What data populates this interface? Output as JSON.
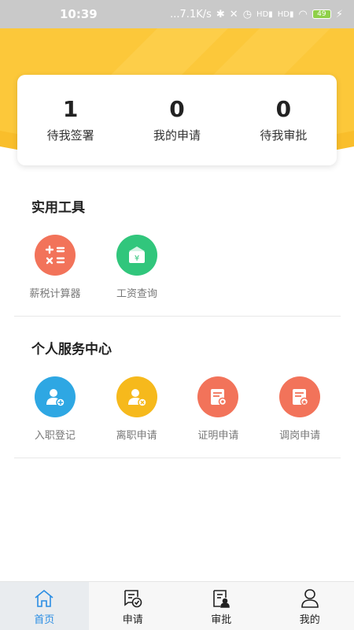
{
  "status_bar": {
    "time": "10:39",
    "network_speed": "...7.1K/s",
    "battery_level": "49"
  },
  "stats": [
    {
      "value": "1",
      "label": "待我签署"
    },
    {
      "value": "0",
      "label": "我的申请"
    },
    {
      "value": "0",
      "label": "待我审批"
    }
  ],
  "tools": {
    "title": "实用工具",
    "items": [
      {
        "label": "薪税计算器",
        "icon": "calculator-icon",
        "color": "#f2735a"
      },
      {
        "label": "工资查询",
        "icon": "salary-envelope-icon",
        "color": "#31c67c"
      }
    ]
  },
  "services": {
    "title": "个人服务中心",
    "items": [
      {
        "label": "入职登记",
        "icon": "user-add-icon",
        "color": "#2ea7e3"
      },
      {
        "label": "离职申请",
        "icon": "user-remove-icon",
        "color": "#f6b91c"
      },
      {
        "label": "证明申请",
        "icon": "certificate-icon",
        "color": "#f2735a"
      },
      {
        "label": "调岗申请",
        "icon": "transfer-document-icon",
        "color": "#f2735a"
      }
    ]
  },
  "tab_bar": {
    "active_color": "#2a8de3",
    "items": [
      {
        "label": "首页",
        "icon": "home-icon"
      },
      {
        "label": "申请",
        "icon": "apply-icon"
      },
      {
        "label": "审批",
        "icon": "approve-icon"
      },
      {
        "label": "我的",
        "icon": "profile-icon"
      }
    ]
  }
}
